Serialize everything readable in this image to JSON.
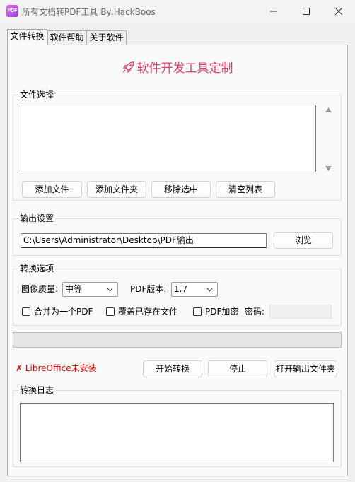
{
  "window": {
    "title": "所有文档转PDF工具      By:HackBoos",
    "icon_text": "PDF"
  },
  "tabs": [
    {
      "label": "文件转换",
      "active": true
    },
    {
      "label": "软件帮助",
      "active": false
    },
    {
      "label": "关于软件",
      "active": false
    }
  ],
  "banner": {
    "text": "软件开发工具定制",
    "icon": "rocket-icon",
    "color": "#e0436e"
  },
  "file_select": {
    "title": "文件选择",
    "files": [],
    "buttons": {
      "add_file": "添加文件",
      "add_folder": "添加文件夹",
      "remove_selected": "移除选中",
      "clear_list": "清空列表"
    }
  },
  "output": {
    "title": "输出设置",
    "path": "C:\\Users\\Administrator\\Desktop\\PDF输出",
    "browse_label": "浏览"
  },
  "options": {
    "title": "转换选项",
    "quality_label": "图像质量:",
    "quality_value": "中等",
    "version_label": "PDF版本:",
    "version_value": "1.7",
    "merge_label": "合并为一个PDF",
    "overwrite_label": "覆盖已存在文件",
    "encrypt_label": "PDF加密",
    "password_label": "密码:",
    "merge_checked": false,
    "overwrite_checked": false,
    "encrypt_checked": false
  },
  "progress": {
    "value": 0
  },
  "status": {
    "text": "✗ LibreOffice未安装",
    "color": "#e00000"
  },
  "actions": {
    "start": "开始转换",
    "stop": "停止",
    "open_folder": "打开输出文件夹"
  },
  "log": {
    "title": "转换日志",
    "text": ""
  }
}
